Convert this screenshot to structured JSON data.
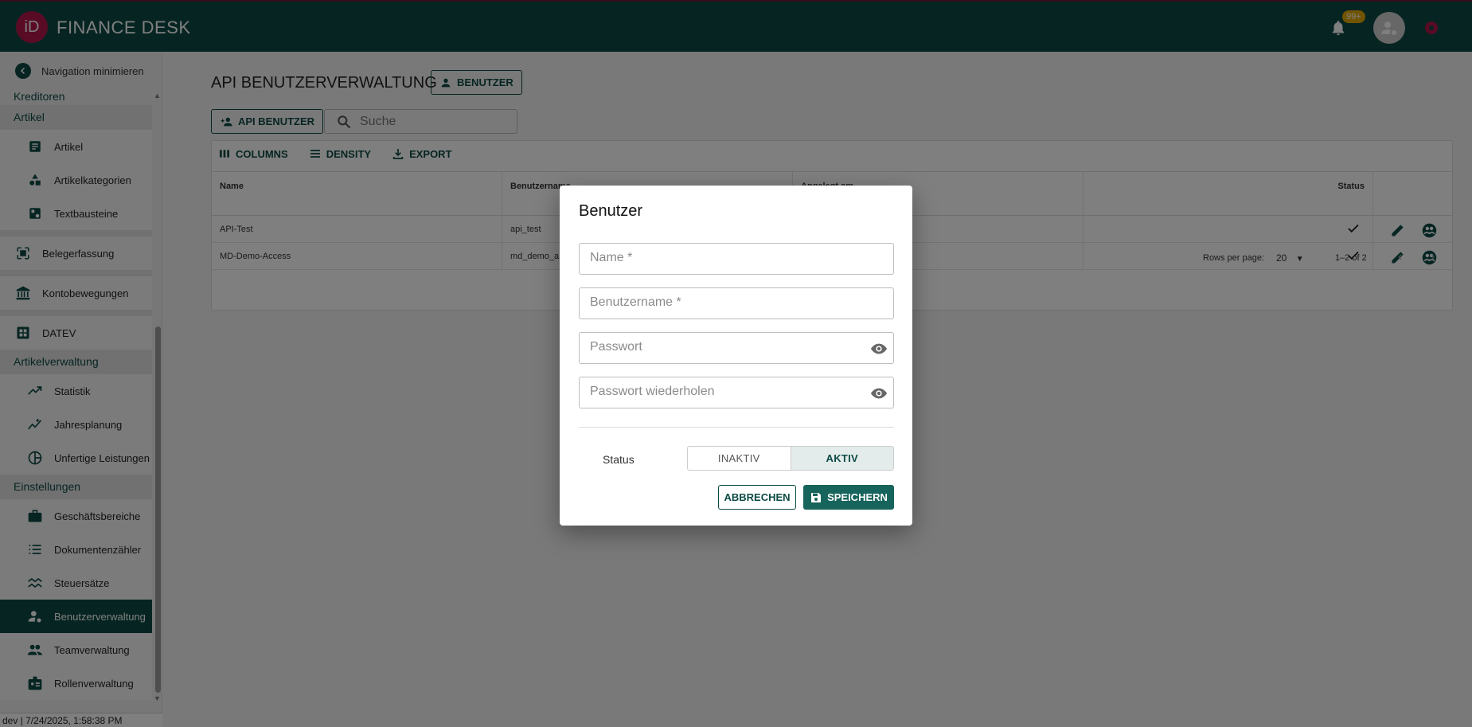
{
  "header": {
    "logo": "iD",
    "title": "FINANCE DESK",
    "notification_badge": "99+"
  },
  "sidebar": {
    "minimize_label": "Navigation minimieren",
    "sections": {
      "kreditoren": "Kreditoren",
      "artikel": "Artikel",
      "artikelverwaltung": "Artikelverwaltung",
      "einstellungen": "Einstellungen"
    },
    "items": {
      "artikel": "Artikel",
      "artikelkategorien": "Artikelkategorien",
      "textbausteine": "Textbausteine",
      "belegerfassung": "Belegerfassung",
      "kontobewegungen": "Kontobewegungen",
      "datev": "DATEV",
      "statistik": "Statistik",
      "jahresplanung": "Jahresplanung",
      "unfertige_leistungen": "Unfertige Leistungen",
      "geschaeftsbereiche": "Geschäftsbereiche",
      "dokumentenzaehler": "Dokumentenzähler",
      "steuersaetze": "Steuersätze",
      "benutzerverwaltung": "Benutzerverwaltung",
      "teamverwaltung": "Teamverwaltung",
      "rollenverwaltung": "Rollenverwaltung"
    },
    "active": "benutzerverwaltung",
    "footer": "dev | 7/24/2025, 1:58:38 PM"
  },
  "main": {
    "title": "API BENUTZERVERWALTUNG",
    "benutzer_button": "BENUTZER",
    "add_button": "API BENUTZER",
    "search_placeholder": "Suche",
    "toolbar": {
      "columns": "COLUMNS",
      "density": "DENSITY",
      "export": "EXPORT"
    },
    "columns": {
      "name": "Name",
      "username": "Benutzername",
      "created": "Angelegt am",
      "status": "Status"
    },
    "rows": [
      {
        "name": "API-Test",
        "username": "api_test"
      },
      {
        "name": "MD-Demo-Access",
        "username": "md_demo_a"
      }
    ],
    "pagination": {
      "rows_per_page_label": "Rows per page:",
      "rows_per_page": "20",
      "range": "1–2 of 2"
    }
  },
  "dialog": {
    "title": "Benutzer",
    "name_placeholder": "Name *",
    "username_placeholder": "Benutzername *",
    "password_placeholder": "Passwort",
    "password_repeat_placeholder": "Passwort wiederholen",
    "status_label": "Status",
    "status_options": [
      "INAKTIV",
      "AKTIV"
    ],
    "status_selected": "AKTIV",
    "cancel_label": "ABBRECHEN",
    "save_label": "SPEICHERN"
  },
  "colors": {
    "primary": "#0c4b45",
    "brand": "#b3174a",
    "badge": "#e0a800"
  }
}
